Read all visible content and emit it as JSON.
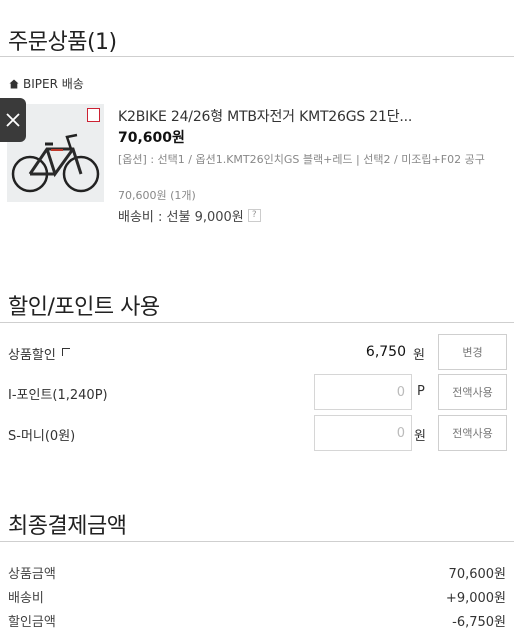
{
  "order": {
    "title": "주문상품(1)",
    "seller": "BIPER 배송",
    "product": {
      "name": "K2BIKE 24/26형 MTB자전거 KMT26GS 21단...",
      "price": "70,600원",
      "option": "[옵션] : 선택1 / 옵션1.KMT26인치GS 블랙+레드 | 선택2 / 미조립+F02 공구",
      "qty": "70,600원 (1개)",
      "shipping": "배송비 : 선불 9,000원",
      "shipping_help": "?"
    }
  },
  "discount": {
    "title": "할인/포인트 사용",
    "rows": [
      {
        "label": "상품할인",
        "value": "6,750",
        "unit": "원",
        "button": "변경"
      },
      {
        "label": "I-포인트(1,240P)",
        "value": "0",
        "unit": "P",
        "button": "전액사용"
      },
      {
        "label": "S-머니(0원)",
        "value": "0",
        "unit": "원",
        "button": "전액사용"
      }
    ]
  },
  "final": {
    "title": "최종결제금액",
    "rows": [
      {
        "label": "상품금액",
        "value": "70,600원"
      },
      {
        "label": "배송비",
        "value": "+9,000원"
      },
      {
        "label": "할인금액",
        "value": "-6,750원"
      }
    ]
  },
  "colors": {
    "divider": "#cfcfcf",
    "text": "#222222",
    "muted": "#888888",
    "close_bg": "#3a3a3a"
  }
}
